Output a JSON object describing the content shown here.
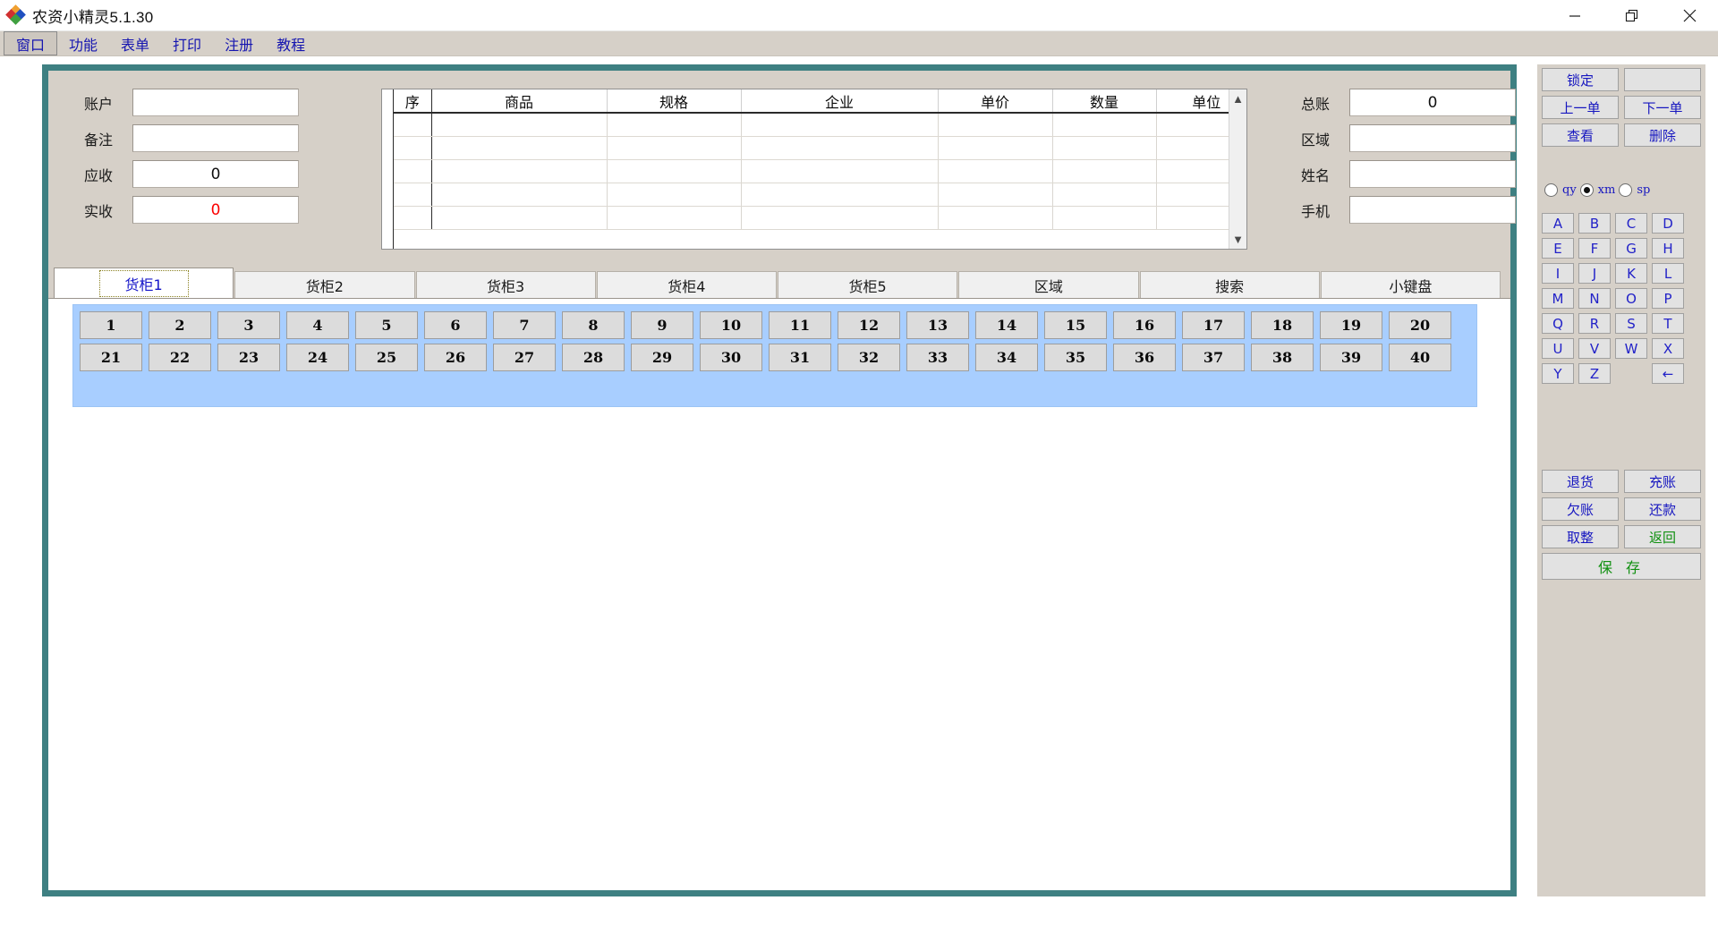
{
  "window": {
    "title": "农资小精灵5.1.30",
    "controls": {
      "minimize": "minimize-icon",
      "restore": "restore-icon",
      "close": "close-icon"
    }
  },
  "menu": {
    "items": [
      "窗口",
      "功能",
      "表单",
      "打印",
      "注册",
      "教程"
    ]
  },
  "left_form": {
    "rows": [
      {
        "label": "账户",
        "value": ""
      },
      {
        "label": "备注",
        "value": ""
      },
      {
        "label": "应收",
        "value": "0"
      },
      {
        "label": "实收",
        "value": "0"
      }
    ]
  },
  "grid": {
    "headers": [
      "序",
      "商品",
      "规格",
      "企业",
      "单价",
      "数量",
      "单位"
    ],
    "rows": [],
    "empty_row_count": 5,
    "scroll_up": "▲",
    "scroll_down": "▼"
  },
  "right_form": {
    "rows": [
      {
        "label": "总账",
        "value": "0"
      },
      {
        "label": "区域",
        "value": ""
      },
      {
        "label": "姓名",
        "value": ""
      },
      {
        "label": "手机",
        "value": ""
      }
    ]
  },
  "tabs": {
    "items": [
      "货柜1",
      "货柜2",
      "货柜3",
      "货柜4",
      "货柜5",
      "区域",
      "搜索",
      "小键盘"
    ],
    "active_index": 0
  },
  "number_pad": {
    "buttons": [
      "1",
      "2",
      "3",
      "4",
      "5",
      "6",
      "7",
      "8",
      "9",
      "10",
      "11",
      "12",
      "13",
      "14",
      "15",
      "16",
      "17",
      "18",
      "19",
      "20",
      "21",
      "22",
      "23",
      "24",
      "25",
      "26",
      "27",
      "28",
      "29",
      "30",
      "31",
      "32",
      "33",
      "34",
      "35",
      "36",
      "37",
      "38",
      "39",
      "40"
    ]
  },
  "sidebar": {
    "lock_button": "锁定",
    "lock_field_value": "",
    "nav": [
      "上一单",
      "下一单"
    ],
    "record": [
      "查看",
      "删除"
    ],
    "radios": [
      {
        "label": "qy",
        "selected": false
      },
      {
        "label": "xm",
        "selected": true
      },
      {
        "label": "sp",
        "selected": false
      }
    ],
    "alpha_keys": [
      [
        "A",
        "B",
        "C",
        "D"
      ],
      [
        "E",
        "F",
        "G",
        "H"
      ],
      [
        "I",
        "J",
        "K",
        "L"
      ],
      [
        "M",
        "N",
        "O",
        "P"
      ],
      [
        "Q",
        "R",
        "S",
        "T"
      ],
      [
        "U",
        "V",
        "W",
        "X"
      ],
      [
        "Y",
        "Z",
        "",
        "←"
      ]
    ],
    "actions": [
      [
        "退货",
        "充账"
      ],
      [
        "欠账",
        "还款"
      ],
      [
        "取整",
        "返回"
      ]
    ],
    "save_label": "保 存"
  },
  "colors": {
    "frame_teal": "#3e8082",
    "window_beige": "#d6d0c8",
    "number_panel_blue": "#a8ceff",
    "link_blue": "#1616c0",
    "green_text": "#109010",
    "red_value": "#fb0000"
  }
}
